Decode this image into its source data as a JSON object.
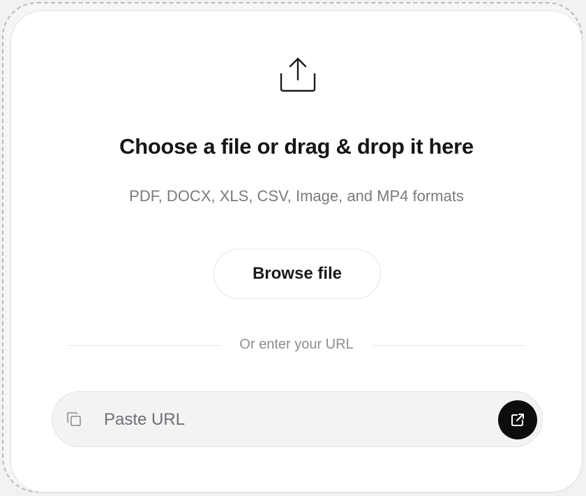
{
  "dropzone": {
    "title": "Choose a file or drag & drop it here",
    "subtitle": "PDF, DOCX, XLS, CSV, Image, and MP4 formats",
    "upload_icon": "upload-icon",
    "browse_label": "Browse file"
  },
  "divider": {
    "text": "Or enter your URL"
  },
  "url": {
    "placeholder": "Paste URL",
    "value": "",
    "copy_icon": "copy-icon",
    "open_icon": "external-link-icon"
  },
  "colors": {
    "button_dark": "#0d0d0f",
    "title": "#161618",
    "muted": "#7a7a80",
    "border": "#e4e4e7"
  }
}
